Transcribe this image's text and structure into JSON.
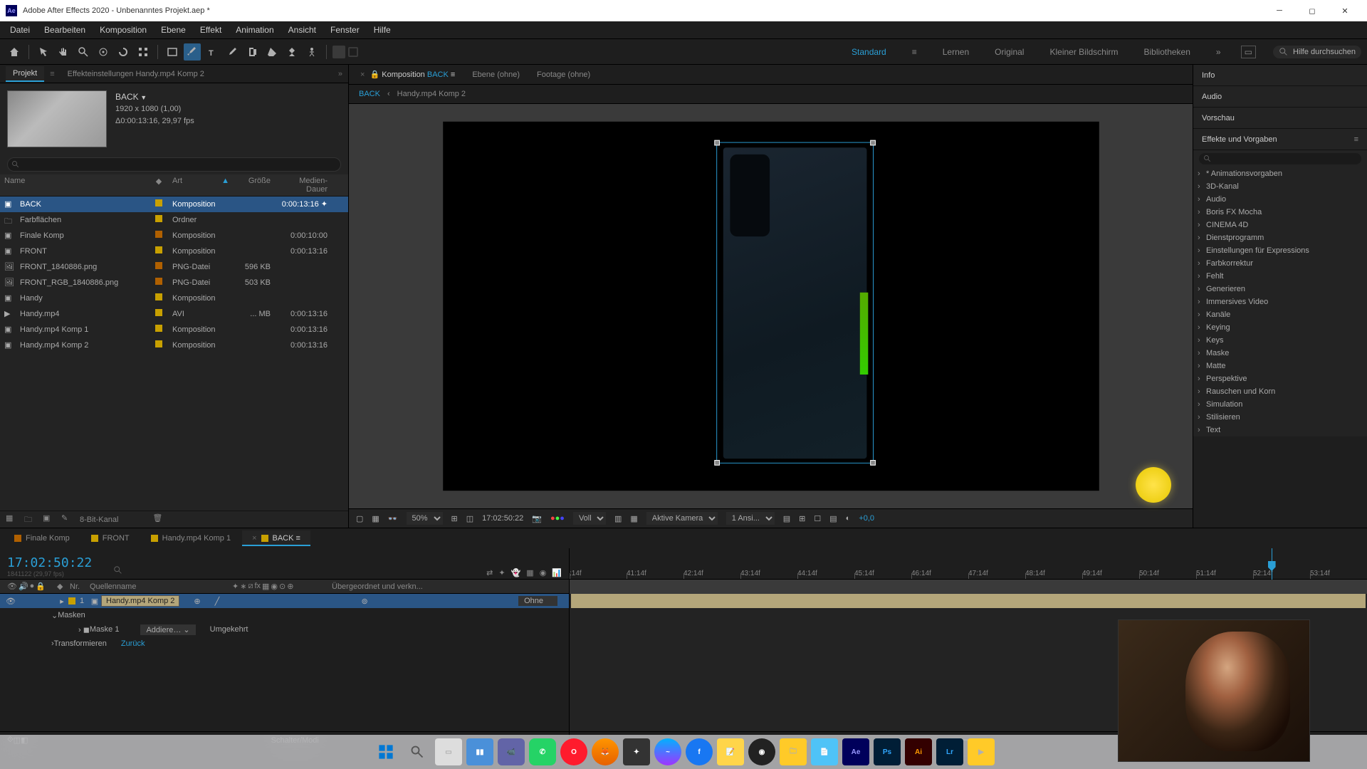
{
  "app": {
    "icon": "Ae",
    "title": "Adobe After Effects 2020 - Unbenanntes Projekt.aep *"
  },
  "menu": [
    "Datei",
    "Bearbeiten",
    "Komposition",
    "Ebene",
    "Effekt",
    "Animation",
    "Ansicht",
    "Fenster",
    "Hilfe"
  ],
  "workspaces": {
    "items": [
      "Standard",
      "Lernen",
      "Original",
      "Kleiner Bildschirm",
      "Bibliotheken"
    ],
    "active": "Standard",
    "search_placeholder": "Hilfe durchsuchen"
  },
  "project": {
    "tab_project": "Projekt",
    "tab_effectcontrols": "Effekteinstellungen Handy.mp4 Komp 2",
    "preview": {
      "title": "BACK",
      "line1": "1920 x 1080 (1,00)",
      "line2": "Δ0:00:13:16, 29,97 fps"
    },
    "cols": {
      "name": "Name",
      "type": "Art",
      "size": "Größe",
      "dur": "Medien-Dauer"
    },
    "rows": [
      {
        "icon": "comp",
        "color": "#c8a000",
        "name": "BACK",
        "type": "Komposition",
        "size": "",
        "dur": "0:00:13:16",
        "selected": true,
        "extra_icon": true
      },
      {
        "icon": "folder",
        "color": "#c8a000",
        "name": "Farbflächen",
        "type": "Ordner",
        "size": "",
        "dur": ""
      },
      {
        "icon": "comp",
        "color": "#b06000",
        "name": "Finale Komp",
        "type": "Komposition",
        "size": "",
        "dur": "0:00:10:00"
      },
      {
        "icon": "comp",
        "color": "#c8a000",
        "name": "FRONT",
        "type": "Komposition",
        "size": "",
        "dur": "0:00:13:16"
      },
      {
        "icon": "png",
        "color": "#b06000",
        "name": "FRONT_1840886.png",
        "type": "PNG-Datei",
        "size": "596 KB",
        "dur": ""
      },
      {
        "icon": "png",
        "color": "#b06000",
        "name": "FRONT_RGB_1840886.png",
        "type": "PNG-Datei",
        "size": "503 KB",
        "dur": ""
      },
      {
        "icon": "comp",
        "color": "#c8a000",
        "name": "Handy",
        "type": "Komposition",
        "size": "",
        "dur": ""
      },
      {
        "icon": "avi",
        "color": "#c8a000",
        "name": "Handy.mp4",
        "type": "AVI",
        "size": "... MB",
        "dur": "0:00:13:16"
      },
      {
        "icon": "comp",
        "color": "#c8a000",
        "name": "Handy.mp4 Komp 1",
        "type": "Komposition",
        "size": "",
        "dur": "0:00:13:16"
      },
      {
        "icon": "comp",
        "color": "#c8a000",
        "name": "Handy.mp4 Komp 2",
        "type": "Komposition",
        "size": "",
        "dur": "0:00:13:16"
      }
    ],
    "footer_bpc": "8-Bit-Kanal"
  },
  "composition": {
    "tabs": [
      {
        "label_prefix": "Komposition",
        "label_name": "BACK",
        "active": true
      },
      {
        "label": "Ebene (ohne)"
      },
      {
        "label": "Footage (ohne)"
      }
    ],
    "breadcrumb": [
      "BACK",
      "Handy.mp4 Komp 2"
    ],
    "footer": {
      "zoom": "50%",
      "timecode": "17:02:50:22",
      "resolution": "Voll",
      "camera": "Aktive Kamera",
      "views": "1 Ansi...",
      "exposure": "+0,0"
    }
  },
  "right_panels": {
    "info": "Info",
    "audio": "Audio",
    "preview": "Vorschau",
    "effects_title": "Effekte und Vorgaben",
    "effects": [
      "* Animationsvorgaben",
      "3D-Kanal",
      "Audio",
      "Boris FX Mocha",
      "CINEMA 4D",
      "Dienstprogramm",
      "Einstellungen für Expressions",
      "Farbkorrektur",
      "Fehlt",
      "Generieren",
      "Immersives Video",
      "Kanäle",
      "Keying",
      "Keys",
      "Maske",
      "Matte",
      "Perspektive",
      "Rauschen und Korn",
      "Simulation",
      "Stilisieren",
      "Text"
    ]
  },
  "timeline": {
    "tabs": [
      {
        "name": "Finale Komp",
        "color": "#b06000"
      },
      {
        "name": "FRONT",
        "color": "#c8a000"
      },
      {
        "name": "Handy.mp4 Komp 1",
        "color": "#c8a000"
      },
      {
        "name": "BACK",
        "color": "#c8a000",
        "active": true
      }
    ],
    "timecode": "17:02:50:22",
    "timecode_sub": "1841122 (29,97 fps)",
    "col_nr": "Nr.",
    "col_src": "Quellenname",
    "col_parent": "Übergeordnet und verkn...",
    "layer": {
      "index": "1",
      "name": "Handy.mp4 Komp 2",
      "parent": "Ohne",
      "masks_label": "Masken",
      "mask1": "Maske 1",
      "mask_mode": "Addiere…",
      "inverted": "Umgekehrt",
      "transform_label": "Transformieren",
      "transform_reset": "Zurück"
    },
    "ruler_ticks": [
      ":14f",
      "41:14f",
      "42:14f",
      "43:14f",
      "44:14f",
      "45:14f",
      "46:14f",
      "47:14f",
      "48:14f",
      "49:14f",
      "50:14f",
      "51:14f",
      "52:14f",
      "53:14f"
    ],
    "footer_label": "Schalter/Modi"
  }
}
